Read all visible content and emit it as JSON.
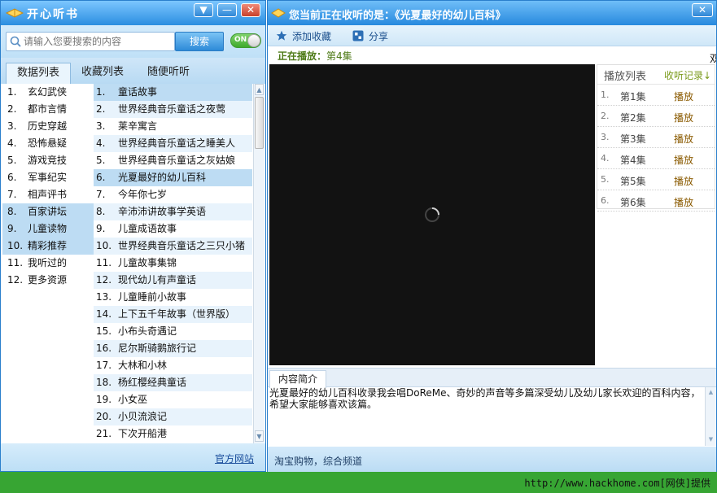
{
  "app": {
    "title": "开心听书"
  },
  "search": {
    "placeholder": "请输入您要搜索的内容",
    "button_label": "搜索",
    "toggle_label": "ON"
  },
  "tabs": [
    {
      "label": "数据列表",
      "active": true
    },
    {
      "label": "收藏列表",
      "active": false
    },
    {
      "label": "随便听听",
      "active": false
    }
  ],
  "categories": [
    {
      "num": "1.",
      "label": "玄幻武侠"
    },
    {
      "num": "2.",
      "label": "都市言情"
    },
    {
      "num": "3.",
      "label": "历史穿越"
    },
    {
      "num": "4.",
      "label": "恐怖悬疑"
    },
    {
      "num": "5.",
      "label": "游戏竞技"
    },
    {
      "num": "6.",
      "label": "军事纪实"
    },
    {
      "num": "7.",
      "label": "相声评书"
    },
    {
      "num": "8.",
      "label": "百家讲坛"
    },
    {
      "num": "9.",
      "label": "儿童读物"
    },
    {
      "num": "10.",
      "label": "精彩推荐"
    },
    {
      "num": "11.",
      "label": "我听过的"
    },
    {
      "num": "12.",
      "label": "更多资源"
    }
  ],
  "items": [
    {
      "num": "1.",
      "label": "童话故事"
    },
    {
      "num": "2.",
      "label": "世界经典音乐童话之夜莺"
    },
    {
      "num": "3.",
      "label": "莱辛寓言"
    },
    {
      "num": "4.",
      "label": "世界经典音乐童话之睡美人"
    },
    {
      "num": "5.",
      "label": "世界经典音乐童话之灰姑娘"
    },
    {
      "num": "6.",
      "label": "光夏最好的幼儿百科"
    },
    {
      "num": "7.",
      "label": "今年你七岁"
    },
    {
      "num": "8.",
      "label": "辛沛沛讲故事学英语"
    },
    {
      "num": "9.",
      "label": "儿童成语故事"
    },
    {
      "num": "10.",
      "label": "世界经典音乐童话之三只小猪"
    },
    {
      "num": "11.",
      "label": "儿童故事集锦"
    },
    {
      "num": "12.",
      "label": "现代幼儿有声童话"
    },
    {
      "num": "13.",
      "label": "儿童睡前小故事"
    },
    {
      "num": "14.",
      "label": "上下五千年故事（世界版）"
    },
    {
      "num": "15.",
      "label": "小布头奇遇记"
    },
    {
      "num": "16.",
      "label": "尼尔斯骑鹅旅行记"
    },
    {
      "num": "17.",
      "label": "大林和小林"
    },
    {
      "num": "18.",
      "label": "杨红樱经典童话"
    },
    {
      "num": "19.",
      "label": "小女巫"
    },
    {
      "num": "20.",
      "label": "小贝流浪记"
    },
    {
      "num": "21.",
      "label": "下次开船港"
    }
  ],
  "left_footer": {
    "link": "官方网站"
  },
  "player": {
    "title": "您当前正在收听的是：《光夏最好的幼儿百科》",
    "toolbar": {
      "favorite": "添加收藏",
      "share": "分享"
    },
    "now_playing_label": "正在播放：",
    "now_playing_episode": "第4集",
    "edge_char": "双",
    "playlist": {
      "tab_label": "播放列表",
      "history_label": "收听记录↓",
      "episodes": [
        {
          "num": "1.",
          "label": "第1集",
          "action": "播放"
        },
        {
          "num": "2.",
          "label": "第2集",
          "action": "播放"
        },
        {
          "num": "3.",
          "label": "第3集",
          "action": "播放"
        },
        {
          "num": "4.",
          "label": "第4集",
          "action": "播放"
        },
        {
          "num": "5.",
          "label": "第5集",
          "action": "播放"
        },
        {
          "num": "6.",
          "label": "第6集",
          "action": "播放"
        }
      ]
    },
    "intro_tab": "内容简介",
    "intro_text": "光夏最好的幼儿百科收录我会唱DoReMe、奇妙的声音等多篇深受幼儿及幼儿家长欢迎的百科内容，希望大家能够喜欢该篇。",
    "footer": "淘宝购物，综合频道"
  },
  "watermark": "http://www.hackhome.com[网侠]提供",
  "icons": {
    "logo": "book-logo-icon",
    "menu": "menu-arrow-icon",
    "minimize": "minimize-icon",
    "close": "close-icon",
    "search": "search-icon",
    "star": "star-icon",
    "share": "share-icon",
    "spinner": "loading-spinner-icon"
  },
  "colors": {
    "accent": "#2b8ee0",
    "selected_row": "#bddcf3",
    "now_playing": "#4d7a16",
    "status_strip": "#37a533"
  }
}
